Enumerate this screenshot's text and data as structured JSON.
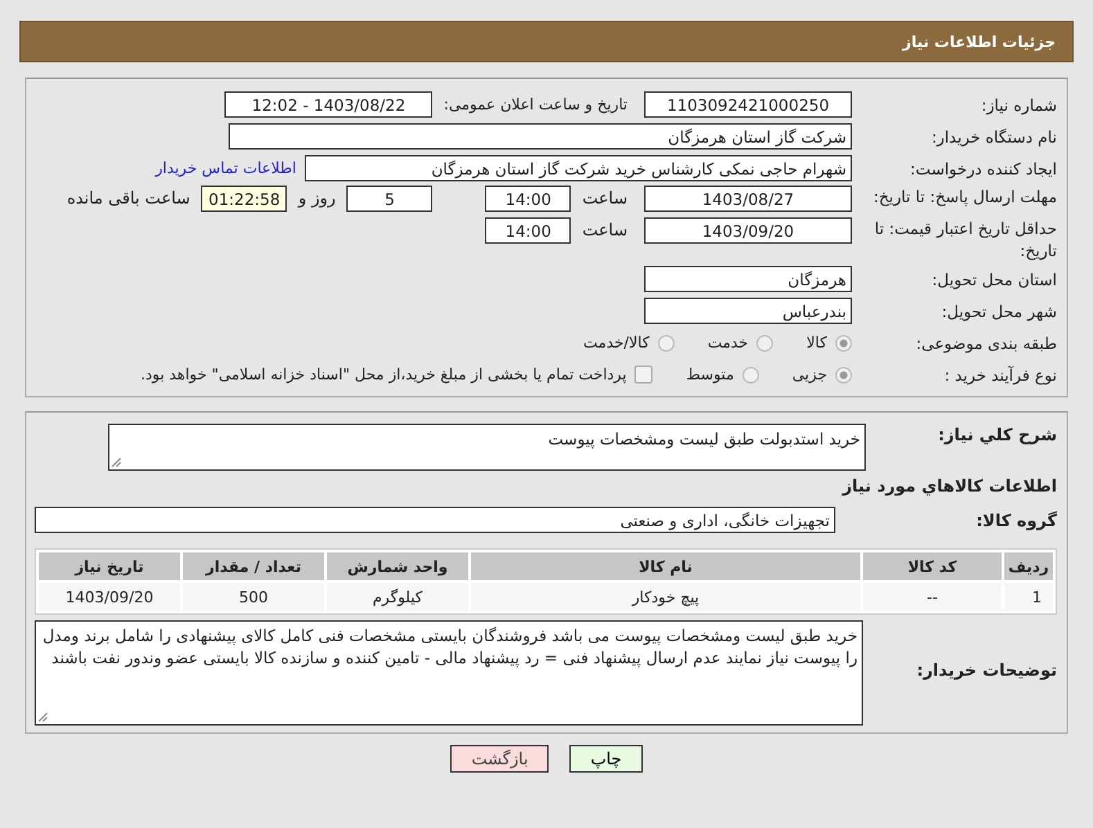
{
  "header": {
    "title": "جزئیات اطلاعات نیاز"
  },
  "need_number": {
    "label": "شماره نیاز:",
    "value": "1103092421000250"
  },
  "announce": {
    "label": "تاریخ و ساعت اعلان عمومی:",
    "value": "1403/08/22 - 12:02"
  },
  "buyer_org": {
    "label": "نام دستگاه خریدار:",
    "value": "شرکت گاز استان هرمزگان"
  },
  "requester": {
    "label": "ایجاد کننده درخواست:",
    "value": "شهرام حاجی نمکی کارشناس خرید شرکت گاز استان هرمزگان",
    "link": "اطلاعات تماس خریدار"
  },
  "reply_deadline": {
    "label": "مهلت ارسال پاسخ: تا تاریخ:",
    "date": "1403/08/27",
    "time_label": "ساعت",
    "time": "14:00",
    "days": "5",
    "days_label": "روز و",
    "remaining": "01:22:58",
    "remaining_label": "ساعت باقی مانده"
  },
  "price_validity": {
    "label": "حداقل تاریخ اعتبار قیمت: تا تاریخ:",
    "date": "1403/09/20",
    "time_label": "ساعت",
    "time": "14:00"
  },
  "province": {
    "label": "استان محل تحویل:",
    "value": "هرمزگان"
  },
  "city": {
    "label": "شهر محل تحویل:",
    "value": "بندرعباس"
  },
  "category": {
    "label": "طبقه بندی موضوعی:",
    "options": [
      {
        "label": "کالا",
        "selected": true
      },
      {
        "label": "خدمت",
        "selected": false
      },
      {
        "label": "کالا/خدمت",
        "selected": false
      }
    ]
  },
  "process": {
    "label": "نوع فرآیند خرید :",
    "options": [
      {
        "label": "جزیی",
        "selected": true
      },
      {
        "label": "متوسط",
        "selected": false
      }
    ],
    "treasury": {
      "label": "پرداخت تمام یا بخشی از مبلغ خرید،از محل \"اسناد خزانه اسلامی\" خواهد بود.",
      "checked": false
    }
  },
  "description": {
    "label": "شرح کلي نياز:",
    "value": "خرید استدبولت طبق لیست ومشخصات پیوست"
  },
  "goods_title": "اطلاعات کالاهاي مورد نياز",
  "goods_group": {
    "label": "گروه کالا:",
    "value": "تجهیزات خانگی، اداری و صنعتی"
  },
  "table": {
    "columns": [
      "ردیف",
      "کد کالا",
      "نام کالا",
      "واحد شمارش",
      "تعداد / مقدار",
      "تاریخ نیاز"
    ],
    "rows": [
      [
        "1",
        "--",
        "پیچ خودکار",
        "کیلوگرم",
        "500",
        "1403/09/20"
      ]
    ]
  },
  "buyer_notes": {
    "label": "توضیحات خریدار:",
    "value": "خرید طبق لیست ومشخصات پیوست می باشد فروشندگان بایستی مشخصات فنی کامل کالای پیشنهادی را شامل برند ومدل را پیوست نیاز نمایند عدم ارسال پیشنهاد فنی = رد پیشنهاد مالی - تامین کننده و سازنده کالا بایستی عضو وندور نفت باشند"
  },
  "buttons": [
    {
      "label": "چاپ",
      "kind": "print"
    },
    {
      "label": "بازگشت",
      "kind": "back"
    }
  ]
}
